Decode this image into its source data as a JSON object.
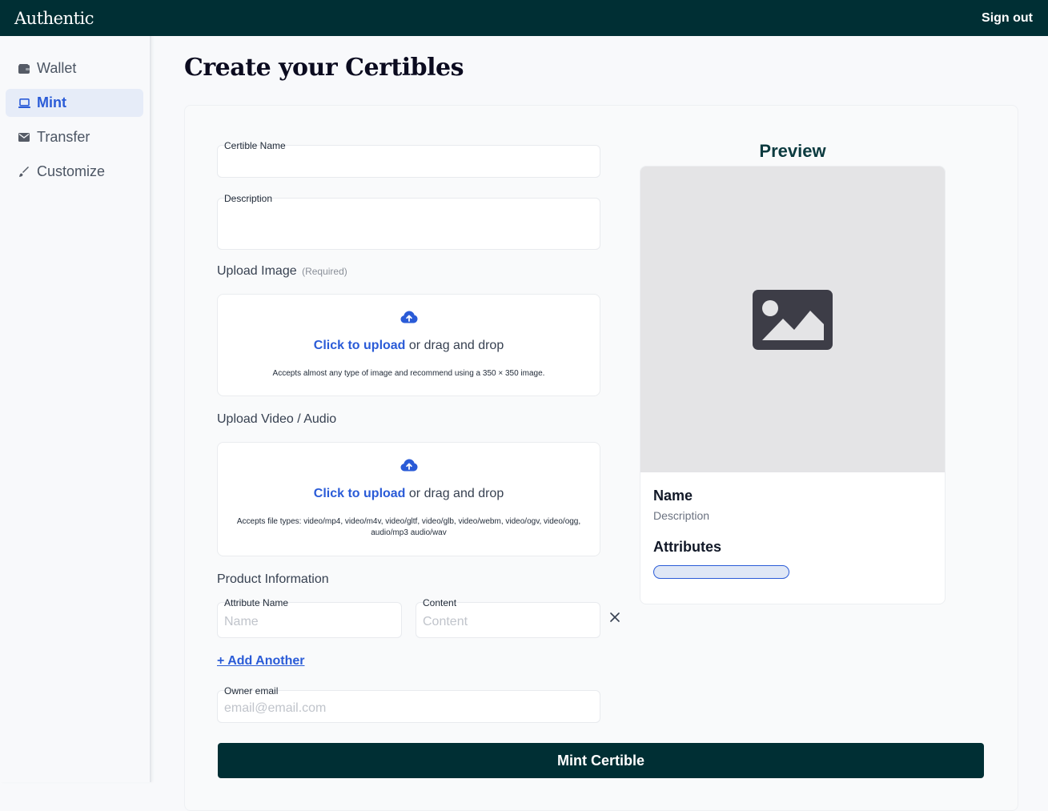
{
  "app": {
    "brand": "Authentic",
    "sign_out": "Sign out"
  },
  "sidebar": {
    "items": [
      {
        "label": "Wallet",
        "icon": "wallet-icon",
        "active": false
      },
      {
        "label": "Mint",
        "icon": "laptop-icon",
        "active": true
      },
      {
        "label": "Transfer",
        "icon": "envelope-icon",
        "active": false
      },
      {
        "label": "Customize",
        "icon": "brush-icon",
        "active": false
      }
    ]
  },
  "page": {
    "title": "Create your Certibles"
  },
  "form": {
    "name_label": "Certible Name",
    "name_value": "",
    "description_label": "Description",
    "description_value": "",
    "upload_image": {
      "title": "Upload Image",
      "required": "(Required)",
      "link": "Click to upload",
      "text": "or drag and drop",
      "hint": "Accepts almost any type of image and recommend using a 350 × 350 image."
    },
    "upload_video": {
      "title": "Upload Video / Audio",
      "link": "Click to upload",
      "text": "or drag and drop",
      "hint": "Accepts file types: video/mp4, video/m4v, video/gltf, video/glb, video/webm, video/ogv, video/ogg, audio/mp3 audio/wav"
    },
    "product_info": {
      "title": "Product Information",
      "attribute_label": "Attribute Name",
      "attribute_placeholder": "Name",
      "content_label": "Content",
      "content_placeholder": "Content"
    },
    "add_another": "+ Add Another",
    "owner_email_label": "Owner email",
    "owner_email_placeholder": "email@email.com",
    "submit": "Mint Certible"
  },
  "preview": {
    "title": "Preview",
    "name": "Name",
    "description": "Description",
    "attributes": "Attributes"
  },
  "colors": {
    "topbar": "#002f34",
    "accent": "#2a5bd7",
    "button": "#002f34"
  }
}
